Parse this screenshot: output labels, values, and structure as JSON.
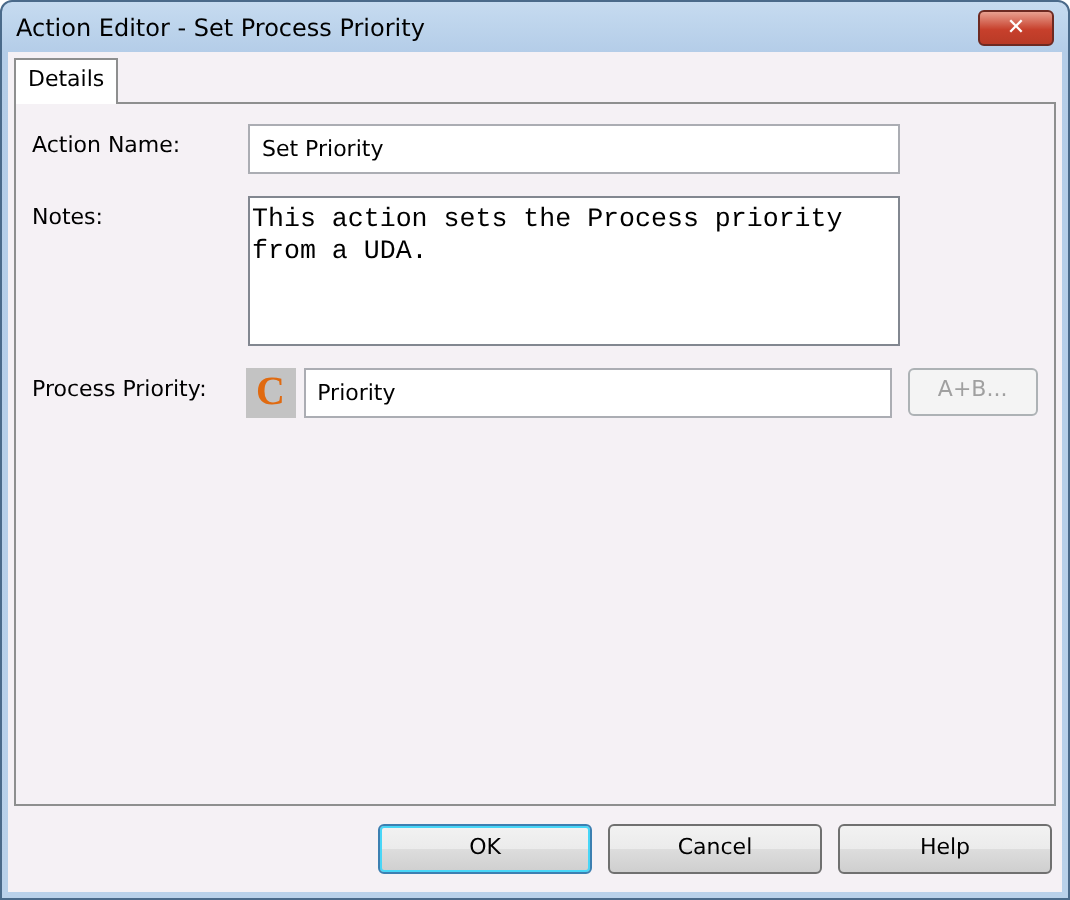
{
  "window": {
    "title": "Action Editor - Set Process Priority",
    "close": "✕"
  },
  "tabs": [
    {
      "label": "Details",
      "selected": true
    }
  ],
  "fields": [
    {
      "kind": "text",
      "label": "Action Name:",
      "value": "Set Priority"
    },
    {
      "kind": "notes",
      "label": "Notes:",
      "value": "This action sets the Process priority from a UDA."
    },
    {
      "kind": "constant",
      "label": "Process Priority:",
      "badge": "C",
      "value": "Priority",
      "button": {
        "label": "A+B...",
        "disabled": true
      }
    }
  ],
  "buttons": [
    {
      "label": "OK",
      "default": true
    },
    {
      "label": "Cancel",
      "default": false
    },
    {
      "label": "Help",
      "default": false
    }
  ]
}
